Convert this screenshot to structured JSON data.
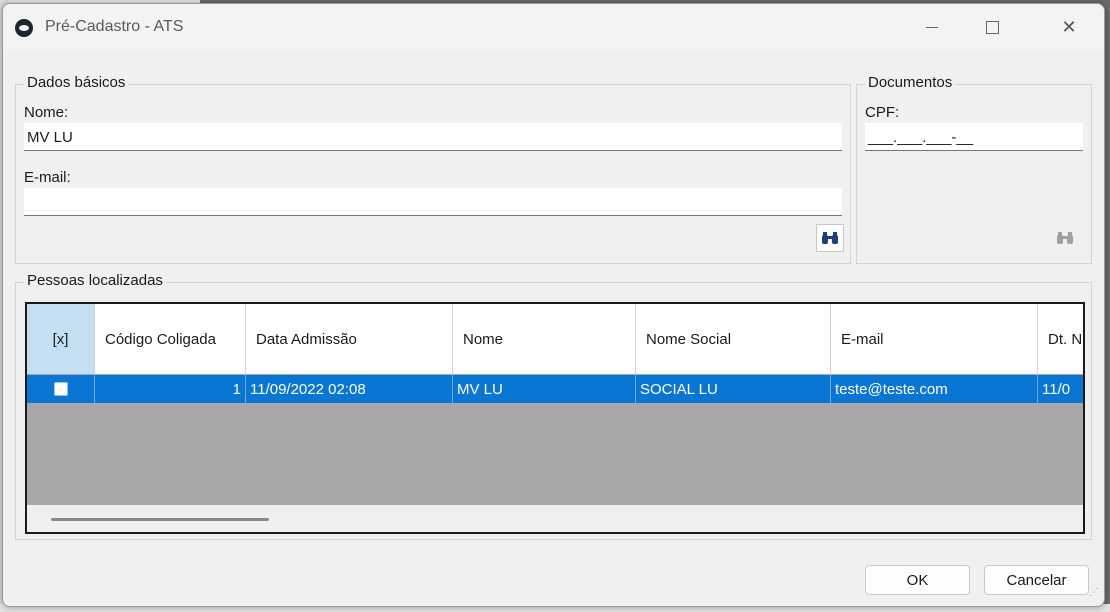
{
  "window": {
    "title": "Pré-Cadastro - ATS",
    "minimize_glyph": "—",
    "close_glyph": "✕"
  },
  "dados_basicos": {
    "title": "Dados básicos",
    "nome_label": "Nome:",
    "nome_value": "MV LU",
    "email_label": "E-mail:",
    "email_value": "",
    "search_icon": "binoculars-icon"
  },
  "documentos": {
    "title": "Documentos",
    "cpf_label": "CPF:",
    "cpf_value": "___.___.___-__",
    "search_icon": "binoculars-icon"
  },
  "pessoas": {
    "title": "Pessoas localizadas",
    "columns": {
      "check": "[x]",
      "codigo": "Código Coligada",
      "data_admissao": "Data Admissão",
      "nome": "Nome",
      "nome_social": "Nome Social",
      "email": "E-mail",
      "dt": "Dt. N"
    },
    "rows": [
      {
        "checked": false,
        "codigo": "1",
        "data_admissao": "11/09/2022 02:08",
        "nome": "MV LU",
        "nome_social": "SOCIAL LU",
        "email": "teste@teste.com",
        "dt": "11/0"
      }
    ]
  },
  "buttons": {
    "ok": "OK",
    "cancel": "Cancelar"
  },
  "colors": {
    "selection": "#0a76d4",
    "header_check": "#c5dff2",
    "grid_empty": "#a8a8a8"
  }
}
